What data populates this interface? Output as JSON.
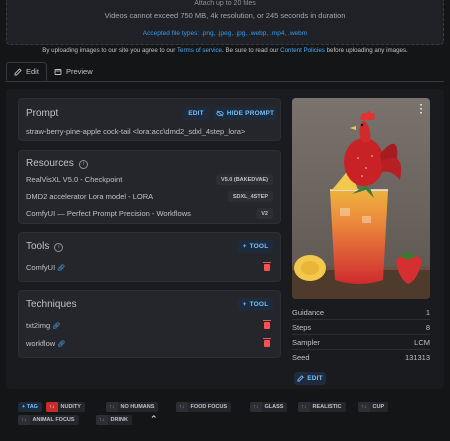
{
  "upload": {
    "attach_limit": "Attach up to 20 files",
    "video_limit": "Videos cannot exceed 750 MB, 4k resolution, or 245 seconds in duration",
    "accepted_types": "Accepted file types: .png, .jpeg, .jpg, .webp, .mp4, .webm"
  },
  "terms": {
    "prefix": "By uploading images to our site you agree to our ",
    "tos_link": "Terms of service",
    "middle": ". Be sure to read our ",
    "policy_link": "Content Policies",
    "suffix": " before uploading any images."
  },
  "tabs": [
    {
      "label": "Edit",
      "icon": "edit-icon"
    },
    {
      "label": "Preview",
      "icon": "preview-icon"
    }
  ],
  "prompt": {
    "title": "Prompt",
    "edit_label": "EDIT",
    "hide_label": "HIDE PROMPT",
    "text": "straw-berry-pine-apple cock-tail <lora:acc\\dmd2_sdxl_4step_lora>"
  },
  "resources": {
    "title": "Resources",
    "items": [
      {
        "name": "RealVisXL V5.0 - Checkpoint",
        "badge": "V5.0 (BAKEDVAE)"
      },
      {
        "name": "DMD2 accelerator Lora model - LORA",
        "badge": "SDXL_4STEP"
      },
      {
        "name": "ComfyUI — Perfect Prompt Precision - Workflows",
        "badge": "V2"
      }
    ]
  },
  "tools": {
    "title": "Tools",
    "add_label": "TOOL",
    "items": [
      {
        "name": "ComfyUI"
      }
    ]
  },
  "techniques": {
    "title": "Techniques",
    "add_label": "TOOL",
    "items": [
      {
        "name": "txt2img"
      },
      {
        "name": "workflow"
      }
    ]
  },
  "meta": [
    {
      "key": "Guidance",
      "value": "1"
    },
    {
      "key": "Steps",
      "value": "8"
    },
    {
      "key": "Sampler",
      "value": "LCM"
    },
    {
      "key": "Seed",
      "value": "131313"
    }
  ],
  "meta_edit_label": "EDIT",
  "tags": {
    "add_label": "TAG",
    "items": [
      {
        "label": "NUDITY",
        "voted": true
      },
      {
        "label": "NO HUMANS",
        "voted": false
      },
      {
        "label": "FOOD FOCUS",
        "voted": false
      },
      {
        "label": "GLASS",
        "voted": false
      },
      {
        "label": "REALISTIC",
        "voted": false
      },
      {
        "label": "CUP",
        "voted": false
      },
      {
        "label": "ANIMAL FOCUS",
        "voted": false
      },
      {
        "label": "DRINK",
        "voted": false
      }
    ]
  },
  "colors": {
    "accent": "#74c0fc",
    "link": "#4dabf7",
    "danger": "#fa5252",
    "nsfw_tag": "#c92a2a",
    "background": "#141517",
    "card": "#25262b"
  }
}
